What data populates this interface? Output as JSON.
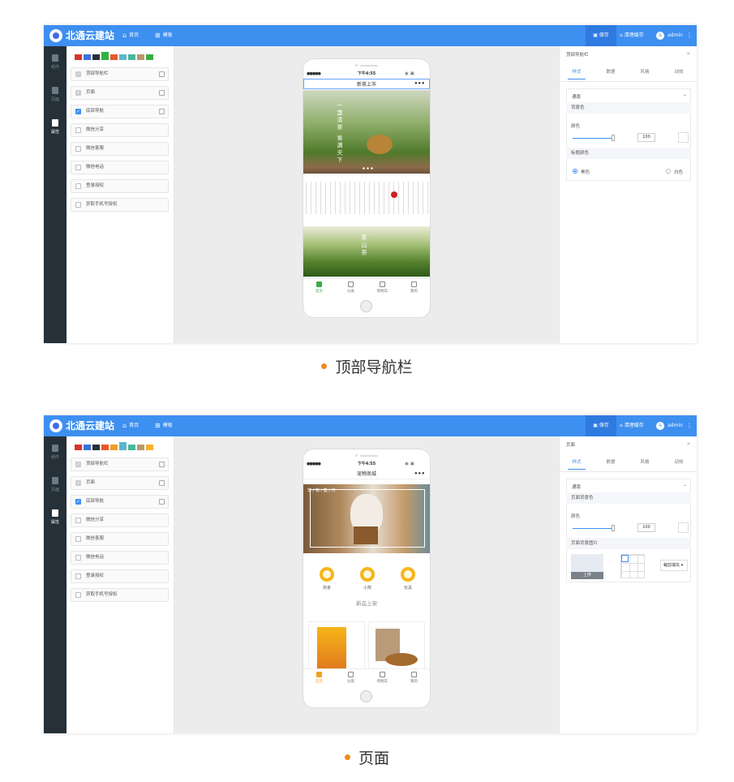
{
  "app": {
    "brand": "北通云建站",
    "nav_home": "首页",
    "nav_template": "模板",
    "save": "保存",
    "clear_cache": "清理缓存",
    "user": "admin",
    "avatar": "头"
  },
  "sidebar": [
    {
      "label": "组件"
    },
    {
      "label": "页面"
    },
    {
      "label": "属性"
    }
  ],
  "swatches1": [
    "#d9342b",
    "#3a73d9",
    "#2a2f36",
    "#2fb344",
    "#e8582a",
    "#5bb6c9",
    "#49b69c",
    "#b9996b",
    "#3aae47"
  ],
  "swatches2": [
    "#d9342b",
    "#3a73d9",
    "#2a2f36",
    "#e8582a",
    "#f29d2a",
    "#5bb6c9",
    "#49b69c",
    "#b9996b",
    "#f4b32d"
  ],
  "components": [
    "顶部导航栏",
    "页面",
    "底部导航",
    "微信分享",
    "微信客服",
    "微信电话",
    "登录授权",
    "获取手机号授权"
  ],
  "phone1": {
    "signal": "●●●●●",
    "time": "下午4:55",
    "right": "◉ ▣",
    "title": "新茶上市",
    "more": "•••",
    "banner_text": "一盏清茶 香满天下",
    "poem": "茗 山 茶",
    "tabs": [
      "首页",
      "分类",
      "购物车",
      "我的"
    ]
  },
  "phone2": {
    "signal": "●●●●●",
    "time": "下午4:55",
    "right": "◉ ▣",
    "title": "宠物商城",
    "more": "•••",
    "banner_text": "宠 / 物 / 集 / 市",
    "cats": [
      "狗食",
      "小窝",
      "玩具"
    ],
    "new_title": "新品上架",
    "tabs": [
      "首页",
      "分类",
      "购物车",
      "我的"
    ]
  },
  "right1": {
    "header": "顶部导航栏",
    "tabs": [
      "样式",
      "数据",
      "风格",
      "动效"
    ],
    "dropdown": "通版",
    "sec_bg": "背景色",
    "color_label": "颜色",
    "value": "100",
    "sec_title_color": "标题颜色",
    "radio_black": "黑色",
    "radio_white": "白色"
  },
  "right2": {
    "header": "页面",
    "tabs": [
      "样式",
      "数据",
      "风格",
      "动效"
    ],
    "dropdown": "通版",
    "sec_bg": "页面背景色",
    "color_label": "颜色",
    "value": "100",
    "sec_img": "页面背景图片",
    "upload": "上传",
    "fill_mode": "裁剪填充"
  },
  "captions": {
    "first": "顶部导航栏",
    "second": "页面"
  }
}
